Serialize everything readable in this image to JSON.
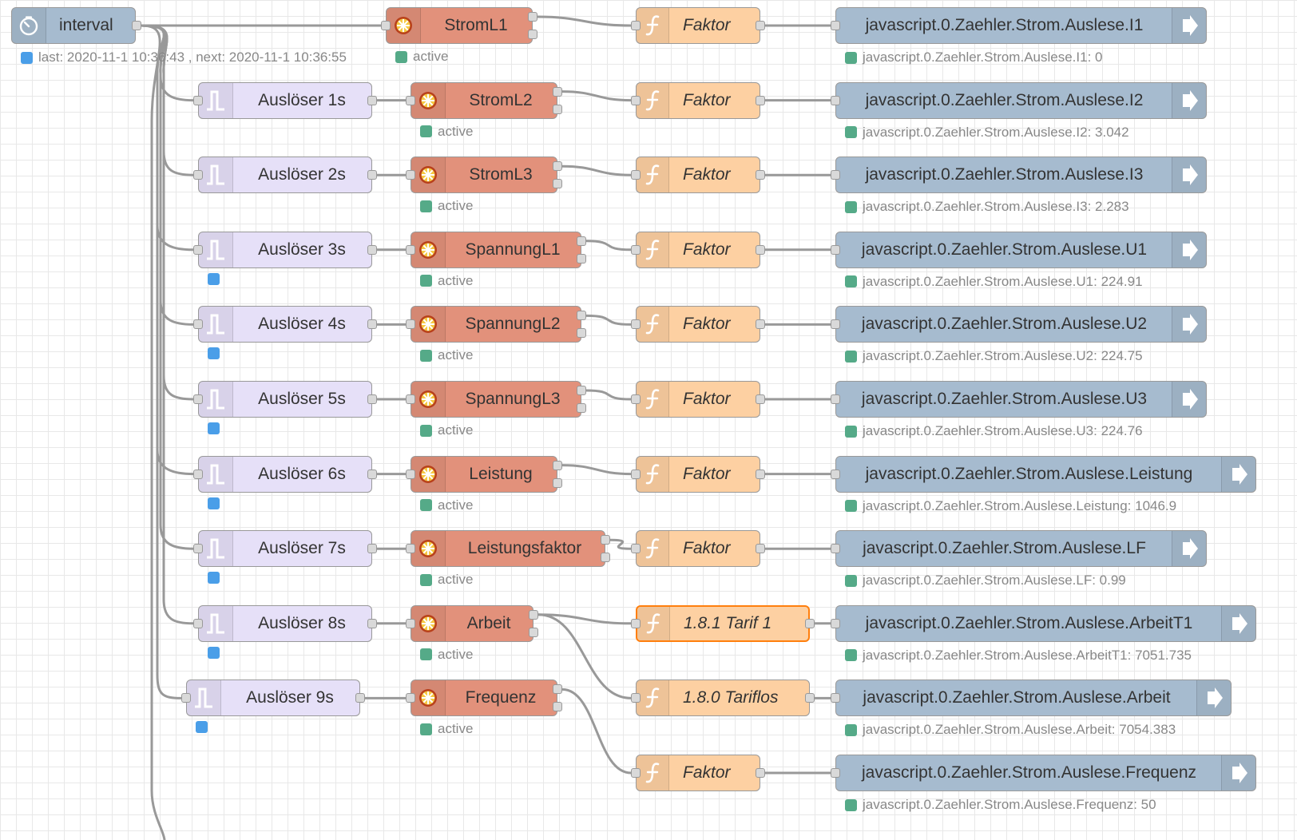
{
  "colors": {
    "inject": "#a6bbcf",
    "trigger": "#e6e0f8",
    "ingress": "#e2917b",
    "function": "#fdd0a2",
    "outgress": "#a6bbcf",
    "wire": "#999999",
    "selected_border": "#ff7f0e",
    "status_green": "#55aa88",
    "status_blue": "#4a9ee8"
  },
  "interval": {
    "label": "interval",
    "icon": "timer-icon",
    "status": "last: 2020-11-1 10:36:43 , next: 2020-11-1 10:36:55"
  },
  "rows": [
    {
      "trigger": "",
      "trigger_status": false,
      "in_label": "StromL1",
      "in_status": "active",
      "func": "Faktor",
      "out_label": "javascript.0.Zaehler.Strom.Auslese.I1",
      "out_status": "javascript.0.Zaehler.Strom.Auslese.I1: 0"
    },
    {
      "trigger": "Auslöser 1s",
      "trigger_status": false,
      "in_label": "StromL2",
      "in_status": "active",
      "func": "Faktor",
      "out_label": "javascript.0.Zaehler.Strom.Auslese.I2",
      "out_status": "javascript.0.Zaehler.Strom.Auslese.I2: 3.042"
    },
    {
      "trigger": "Auslöser 2s",
      "trigger_status": false,
      "in_label": "StromL3",
      "in_status": "active",
      "func": "Faktor",
      "out_label": "javascript.0.Zaehler.Strom.Auslese.I3",
      "out_status": "javascript.0.Zaehler.Strom.Auslese.I3: 2.283"
    },
    {
      "trigger": "Auslöser 3s",
      "trigger_status": true,
      "in_label": "SpannungL1",
      "in_status": "active",
      "func": "Faktor",
      "out_label": "javascript.0.Zaehler.Strom.Auslese.U1",
      "out_status": "javascript.0.Zaehler.Strom.Auslese.U1: 224.91"
    },
    {
      "trigger": "Auslöser 4s",
      "trigger_status": true,
      "in_label": "SpannungL2",
      "in_status": "active",
      "func": "Faktor",
      "out_label": "javascript.0.Zaehler.Strom.Auslese.U2",
      "out_status": "javascript.0.Zaehler.Strom.Auslese.U2: 224.75"
    },
    {
      "trigger": "Auslöser 5s",
      "trigger_status": true,
      "in_label": "SpannungL3",
      "in_status": "active",
      "func": "Faktor",
      "out_label": "javascript.0.Zaehler.Strom.Auslese.U3",
      "out_status": "javascript.0.Zaehler.Strom.Auslese.U3: 224.76"
    },
    {
      "trigger": "Auslöser 6s",
      "trigger_status": true,
      "in_label": "Leistung",
      "in_status": "active",
      "func": "Faktor",
      "out_label": "javascript.0.Zaehler.Strom.Auslese.Leistung",
      "out_status": "javascript.0.Zaehler.Strom.Auslese.Leistung: 1046.9"
    },
    {
      "trigger": "Auslöser 7s",
      "trigger_status": true,
      "in_label": "Leistungsfaktor",
      "in_status": "active",
      "func": "Faktor",
      "out_label": "javascript.0.Zaehler.Strom.Auslese.LF",
      "out_status": "javascript.0.Zaehler.Strom.Auslese.LF: 0.99"
    },
    {
      "trigger": "Auslöser 8s",
      "trigger_status": true,
      "in_label": "Arbeit",
      "in_status": "active",
      "func": "1.8.1 Tarif 1",
      "out_label": "javascript.0.Zaehler.Strom.Auslese.ArbeitT1",
      "out_status": "javascript.0.Zaehler.Strom.Auslese.ArbeitT1: 7051.735"
    },
    {
      "trigger": "Auslöser 9s",
      "trigger_status": true,
      "in_label": "Frequenz",
      "in_status": "active",
      "func": "1.8.0 Tariflos",
      "out_label": "javascript.0.Zaehler.Strom.Auslese.Arbeit",
      "out_status": "javascript.0.Zaehler.Strom.Auslese.Arbeit: 7054.383"
    }
  ],
  "extra_function": {
    "func": "Faktor",
    "out_label": "javascript.0.Zaehler.Strom.Auslese.Frequenz",
    "out_status": "javascript.0.Zaehler.Strom.Auslese.Frequenz: 50"
  },
  "icons": {
    "trigger": "trigger-pulse-icon",
    "ingress": "ingress-gear-icon",
    "function": "function-icon",
    "outgress": "arrow-right-icon"
  }
}
